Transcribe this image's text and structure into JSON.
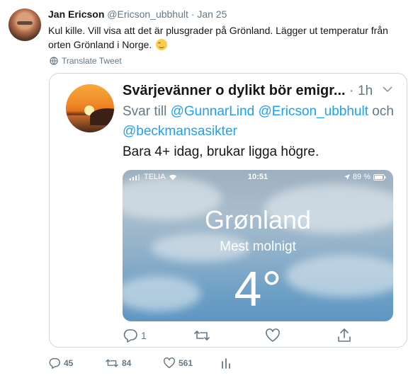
{
  "tweet": {
    "author_name": "Jan Ericson",
    "author_handle": "@Ericson_ubbhult",
    "separator": "·",
    "date": "Jan 25",
    "text": "Kul kille. Vill visa att det är plusgrader på Grönland. Lägger ut temperatur från orten Grönland i Norge.",
    "translate_label": "Translate Tweet",
    "counts": {
      "replies": "45",
      "retweets": "84",
      "likes": "561"
    }
  },
  "quoted": {
    "author_name": "Svärjevänner o dylikt bör emigr...",
    "separator": "·",
    "time": "1h",
    "reply_prefix": "Svar till",
    "mention1": "@GunnarLind",
    "mention2": "@Ericson_ubbhult",
    "and_word": "och",
    "mention3": "@beckmansasikter",
    "text": "Bara 4+ idag, brukar ligga högre.",
    "reply_count": "1",
    "screenshot": {
      "carrier": "TELIA",
      "clock": "10:51",
      "battery": "89 %",
      "city": "Grønland",
      "condition": "Mest molnigt",
      "temperature": "4°"
    }
  },
  "icons": {
    "globe": "globe-icon",
    "caret": "chevron-down-icon",
    "reply": "reply-icon",
    "retweet": "retweet-icon",
    "like": "heart-icon",
    "share": "share-icon",
    "analytics": "analytics-icon",
    "emoji": "smiling-face-emoji"
  },
  "colors": {
    "link": "#1da1f2",
    "muted": "#657786",
    "text": "#14171a",
    "border": "#ccd6dd"
  }
}
